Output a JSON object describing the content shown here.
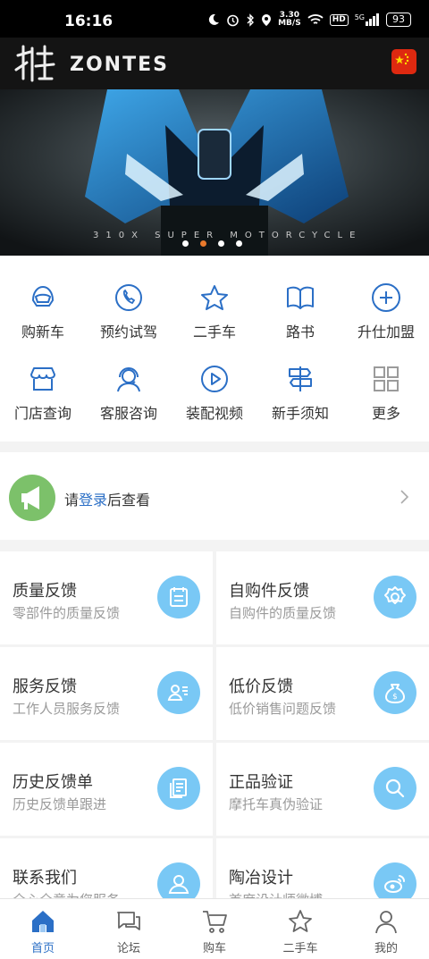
{
  "status_bar": {
    "time": "16:16",
    "net_speed_value": "3.30",
    "net_speed_unit": "MB/S",
    "hd": "HD",
    "signal": "5G",
    "battery": "93"
  },
  "header": {
    "brand_en": "ZONTES",
    "flag": "china-flag"
  },
  "banner": {
    "caption": "310X SUPER MOTORCYCLE",
    "slides": 4,
    "active_slide": 2
  },
  "menu": {
    "items": [
      {
        "label": "购新车",
        "icon": "helmet-icon"
      },
      {
        "label": "预约试驾",
        "icon": "phone-icon"
      },
      {
        "label": "二手车",
        "icon": "star-icon"
      },
      {
        "label": "路书",
        "icon": "book-icon"
      },
      {
        "label": "升仕加盟",
        "icon": "plus-circle-icon"
      },
      {
        "label": "门店查询",
        "icon": "store-icon"
      },
      {
        "label": "客服咨询",
        "icon": "headset-icon"
      },
      {
        "label": "装配视频",
        "icon": "play-icon"
      },
      {
        "label": "新手须知",
        "icon": "signpost-icon"
      },
      {
        "label": "更多",
        "icon": "grid-icon"
      }
    ]
  },
  "notice": {
    "prefix": "请",
    "link": "登录",
    "suffix": "后查看"
  },
  "cards": [
    {
      "title": "质量反馈",
      "subtitle": "零部件的质量反馈",
      "icon": "calendar-icon"
    },
    {
      "title": "自购件反馈",
      "subtitle": "自购件的质量反馈",
      "icon": "gear-icon"
    },
    {
      "title": "服务反馈",
      "subtitle": "工作人员服务反馈",
      "icon": "staff-card-icon"
    },
    {
      "title": "低价反馈",
      "subtitle": "低价销售问题反馈",
      "icon": "money-bag-icon"
    },
    {
      "title": "历史反馈单",
      "subtitle": "历史反馈单跟进",
      "icon": "documents-icon"
    },
    {
      "title": "正品验证",
      "subtitle": "摩托车真伪验证",
      "icon": "search-icon"
    },
    {
      "title": "联系我们",
      "subtitle": "全心全意为您服务",
      "icon": "contact-icon"
    },
    {
      "title": "陶冶设计",
      "subtitle": "首席设计师微博",
      "icon": "weibo-icon"
    }
  ],
  "tabbar": {
    "tabs": [
      {
        "label": "首页",
        "icon": "home-icon",
        "active": true
      },
      {
        "label": "论坛",
        "icon": "chat-icon",
        "active": false
      },
      {
        "label": "购车",
        "icon": "cart-icon",
        "active": false
      },
      {
        "label": "二手车",
        "icon": "star-icon",
        "active": false
      },
      {
        "label": "我的",
        "icon": "user-icon",
        "active": false
      }
    ]
  },
  "colors": {
    "accent": "#2b6fc6",
    "card_icon_bg": "#79c8f5",
    "notice_icon_bg": "#7cc16a",
    "banner_dot_active": "#e8792c"
  }
}
